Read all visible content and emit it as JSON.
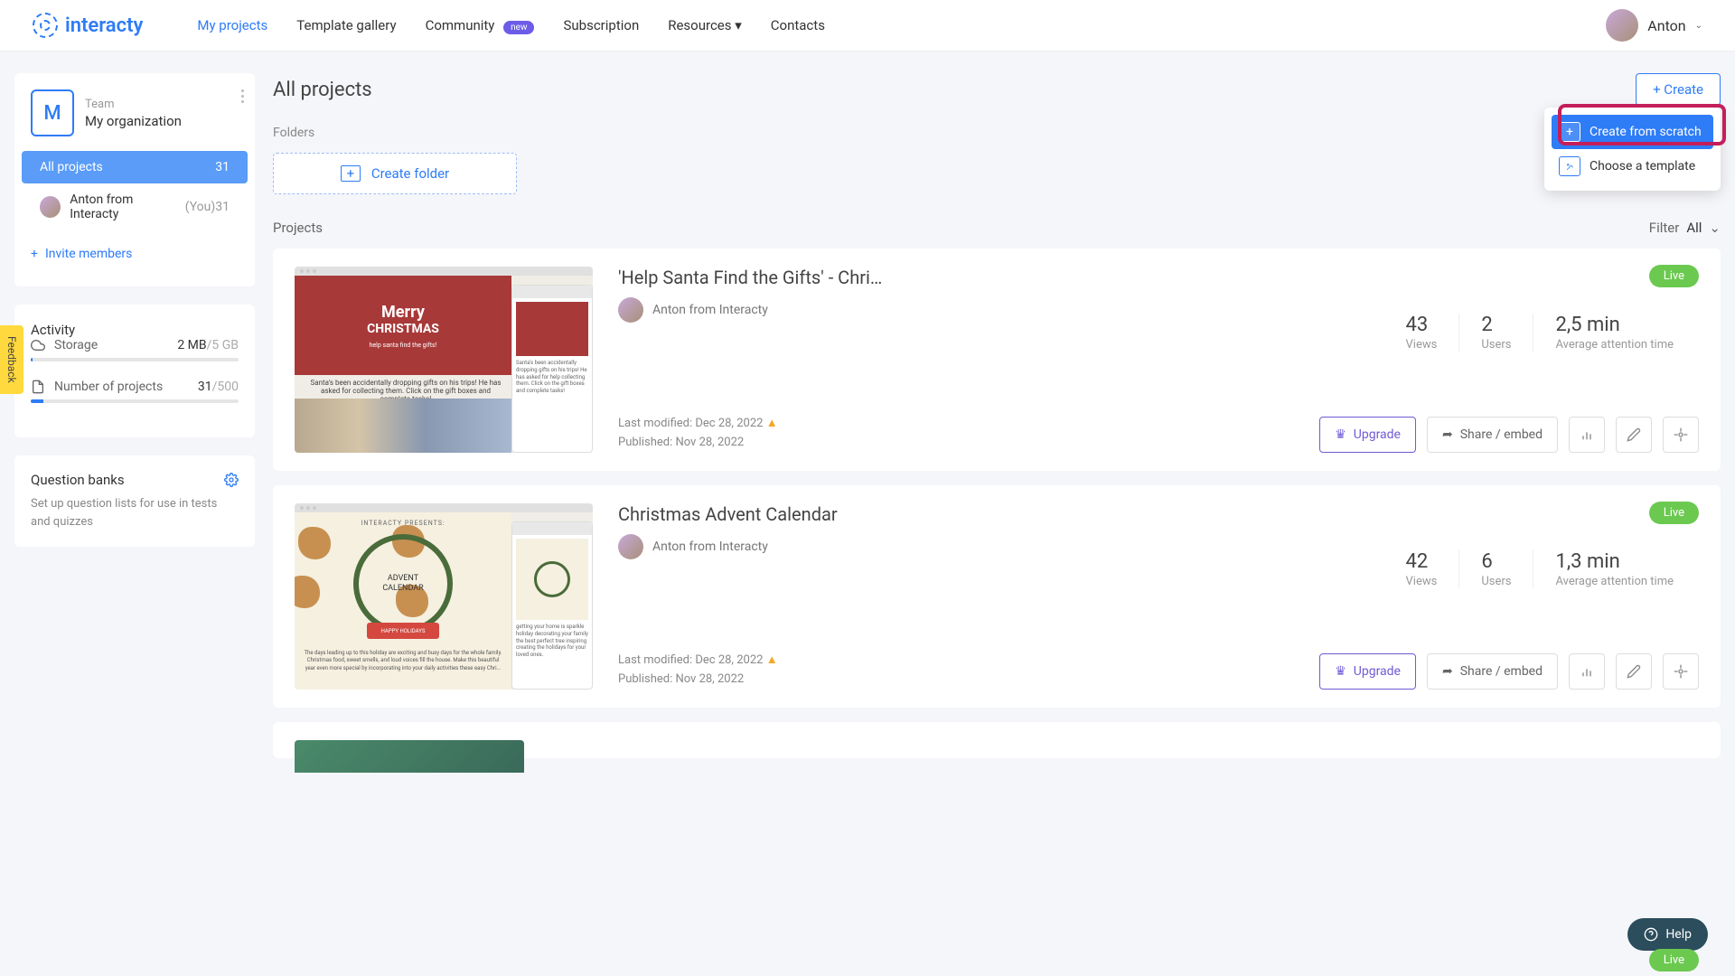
{
  "brand": "interacty",
  "nav": {
    "my_projects": "My projects",
    "template_gallery": "Template gallery",
    "community": "Community",
    "new_badge": "new",
    "subscription": "Subscription",
    "resources": "Resources",
    "contacts": "Contacts"
  },
  "user": {
    "name": "Anton"
  },
  "team": {
    "initial": "M",
    "label": "Team",
    "name": "My organization"
  },
  "sidebar": {
    "all_projects": "All projects",
    "all_count": "31",
    "member_name": "Anton from Interacty",
    "you": "(You)",
    "member_count": "31",
    "invite": "Invite members"
  },
  "activity": {
    "title": "Activity",
    "storage_label": "Storage",
    "storage_used": "2 MB",
    "storage_total": "/5 GB",
    "projects_label": "Number of projects",
    "projects_used": "31",
    "projects_total": "/500"
  },
  "qbank": {
    "title": "Question banks",
    "desc": "Set up question lists for use in tests and quizzes"
  },
  "main": {
    "title": "All projects",
    "create_btn": "+ Create",
    "dd_scratch": "Create from scratch",
    "dd_template": "Choose a template",
    "folders_label": "Folders",
    "create_folder": "Create folder",
    "projects_label": "Projects",
    "filter_label": "Filter",
    "filter_value": "All"
  },
  "actions": {
    "upgrade": "Upgrade",
    "share": "Share / embed",
    "live": "Live"
  },
  "projects": [
    {
      "title": "'Help Santa Find the Gifts' - Chri…",
      "author": "Anton from Interacty",
      "views": "43",
      "views_label": "Views",
      "users": "2",
      "users_label": "Users",
      "att": "2,5 min",
      "att_label": "Average attention time",
      "modified": "Last modified: Dec 28, 2022",
      "published": "Published: Nov 28, 2022"
    },
    {
      "title": "Christmas Advent Calendar",
      "author": "Anton from Interacty",
      "views": "42",
      "views_label": "Views",
      "users": "6",
      "users_label": "Users",
      "att": "1,3 min",
      "att_label": "Average attention time",
      "modified": "Last modified: Dec 28, 2022",
      "published": "Published: Nov 28, 2022"
    }
  ],
  "feedback": "Feedback",
  "help": "Help"
}
